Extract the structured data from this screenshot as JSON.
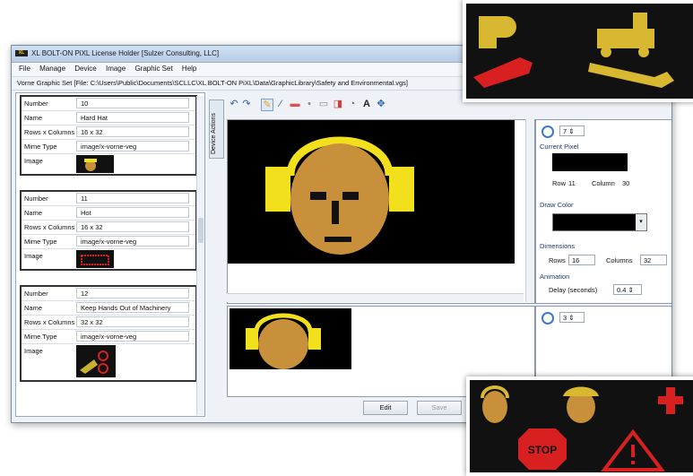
{
  "window": {
    "title": "XL BOLT-ON PiXL   License Holder [Sulzer Consulting, LLC]",
    "logo_text": "XL"
  },
  "menu": [
    "File",
    "Manage",
    "Device",
    "Image",
    "Graphic Set",
    "Help"
  ],
  "path": "Vorne Graphic Set [File: C:\\Users\\Public\\Documents\\SCLLC\\XL BOLT-ON PiXL\\Data\\GraphicLibrary\\Safety and Environmental.vgs]",
  "labels": {
    "number": "Number",
    "name": "Name",
    "rows_columns": "Rows x Columns",
    "mime_type": "Mime Type",
    "image": "Image"
  },
  "graphics": [
    {
      "number": "10",
      "name": "Hard Hat",
      "rows_columns": "16   x   32",
      "mime": "image/x-vorne-veg"
    },
    {
      "number": "11",
      "name": "Hot",
      "rows_columns": "16   x   32",
      "mime": "image/x-vorne-veg"
    },
    {
      "number": "12",
      "name": "Keep Hands Out of Machinery",
      "rows_columns": "32   x   32",
      "mime": "image/x-vorne-veg"
    }
  ],
  "device_actions_tab": "Device Actions",
  "properties": {
    "zoom": "7",
    "current_pixel_label": "Current Pixel",
    "row_label": "Row",
    "row_value": "11",
    "column_label": "Column",
    "column_value": "30",
    "draw_color_label": "Draw Color",
    "dimensions_label": "Dimensions",
    "rows_label": "Rows",
    "rows_value": "16",
    "columns_label": "Columns",
    "columns_value": "32",
    "animation_label": "Animation",
    "delay_label": "Delay (seconds)",
    "delay_value": "0.4"
  },
  "preview_zoom": "3",
  "buttons": {
    "edit": "Edit",
    "save": "Save"
  },
  "overlay_text": {
    "stop": "STOP"
  },
  "colors": {
    "pixel_on": "#c8903a",
    "pixel_yellow": "#f2e01c",
    "pixel_off": "#111111",
    "pixel_red": "#d92020"
  }
}
